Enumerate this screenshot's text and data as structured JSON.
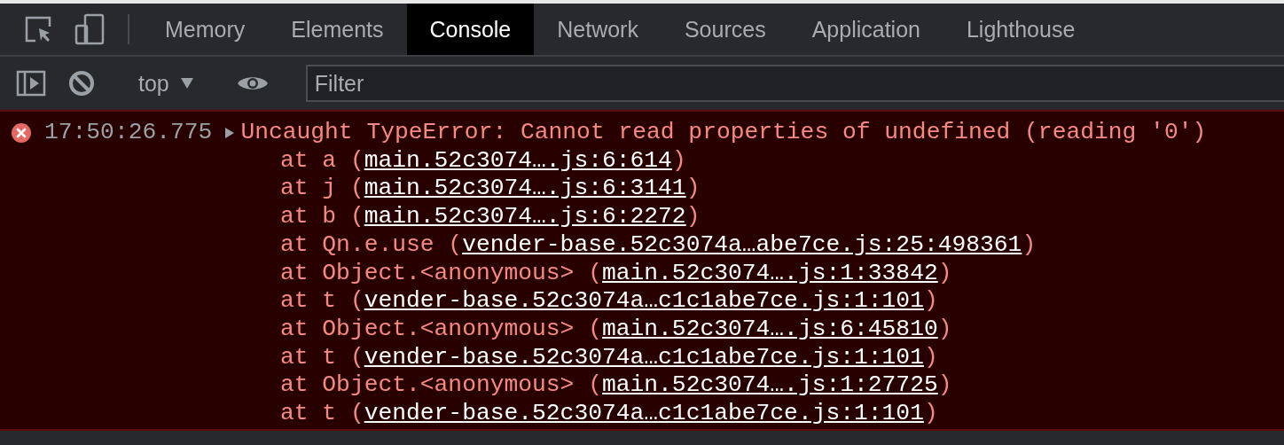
{
  "tabs": [
    {
      "label": "Memory",
      "selected": false
    },
    {
      "label": "Elements",
      "selected": false
    },
    {
      "label": "Console",
      "selected": true
    },
    {
      "label": "Network",
      "selected": false
    },
    {
      "label": "Sources",
      "selected": false
    },
    {
      "label": "Application",
      "selected": false
    },
    {
      "label": "Lighthouse",
      "selected": false
    }
  ],
  "toolbar": {
    "context": "top",
    "filter": {
      "placeholder": "Filter"
    }
  },
  "messages": [
    {
      "kind": "error",
      "time": "17:50:26.775",
      "expanded": false,
      "text": "Uncaught TypeError: Cannot read properties of undefined (reading '0')",
      "stack": [
        {
          "prefix": "at a (",
          "link": "main.52c3074….js:6:614",
          "suffix": ")"
        },
        {
          "prefix": "at j (",
          "link": "main.52c3074….js:6:3141",
          "suffix": ")"
        },
        {
          "prefix": "at b (",
          "link": "main.52c3074….js:6:2272",
          "suffix": ")"
        },
        {
          "prefix": "at Qn.e.use (",
          "link": "vender-base.52c3074a…abe7ce.js:25:498361",
          "suffix": ")"
        },
        {
          "prefix": "at Object.<anonymous> (",
          "link": "main.52c3074….js:1:33842",
          "suffix": ")"
        },
        {
          "prefix": "at t (",
          "link": "vender-base.52c3074a…c1c1abe7ce.js:1:101",
          "suffix": ")"
        },
        {
          "prefix": "at Object.<anonymous> (",
          "link": "main.52c3074….js:6:45810",
          "suffix": ")"
        },
        {
          "prefix": "at t (",
          "link": "vender-base.52c3074a…c1c1abe7ce.js:1:101",
          "suffix": ")"
        },
        {
          "prefix": "at Object.<anonymous> (",
          "link": "main.52c3074….js:1:27725",
          "suffix": ")"
        },
        {
          "prefix": "at t (",
          "link": "vender-base.52c3074a…c1c1abe7ce.js:1:101",
          "suffix": ")"
        }
      ]
    }
  ]
}
